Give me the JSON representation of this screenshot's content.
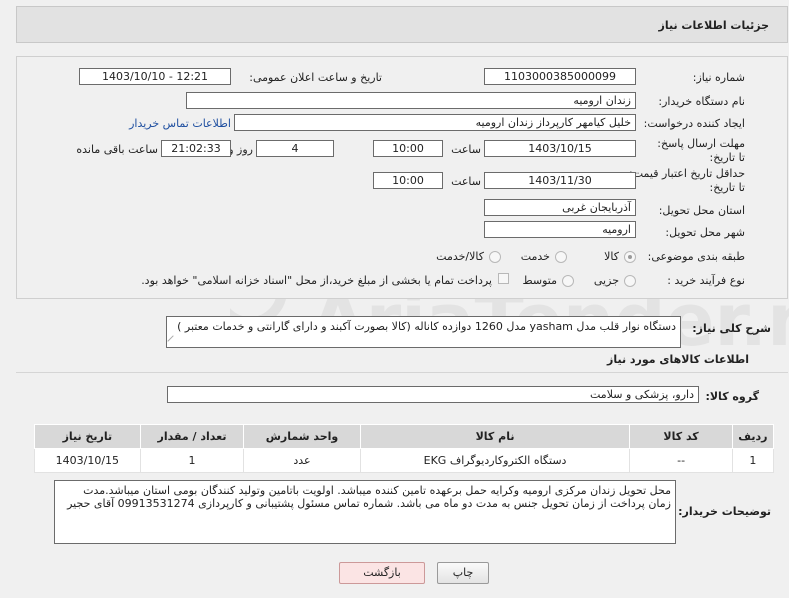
{
  "header": {
    "title": "جزئیات اطلاعات نیاز"
  },
  "form": {
    "need_number_label": "شماره نیاز:",
    "need_number": "1103000385000099",
    "announce_label": "تاریخ و ساعت اعلان عمومی:",
    "announce_value": "1403/10/10 - 12:21",
    "buyer_label": "نام دستگاه خریدار:",
    "buyer_value": "زندان ارومیه",
    "creator_label": "ایجاد کننده درخواست:",
    "creator_value": "خلیل کیامهر کارپرداز زندان ارومیه",
    "contact_link": "اطلاعات تماس خریدار",
    "deadline_label": "مهلت ارسال پاسخ: تا تاریخ:",
    "deadline_date": "1403/10/15",
    "time_label": "ساعت",
    "deadline_time": "10:00",
    "days_value": "4",
    "days_label": "روز و",
    "remaining_time": "21:02:33",
    "remaining_label": "ساعت باقی مانده",
    "validity_label": "حداقل تاریخ اعتبار قیمت: تا تاریخ:",
    "validity_date": "1403/11/30",
    "validity_time": "10:00",
    "province_label": "استان محل تحویل:",
    "province_value": "آذربایجان غربی",
    "city_label": "شهر محل تحویل:",
    "city_value": "ارومیه",
    "category_label": "طبقه بندی موضوعی:",
    "category_options": [
      "کالا",
      "خدمت",
      "کالا/خدمت"
    ],
    "process_label": "نوع فرآیند خرید :",
    "process_options": [
      "جزیی",
      "متوسط"
    ],
    "payment_note": "پرداخت تمام یا بخشی از مبلغ خرید،از محل \"اسناد خزانه اسلامی\" خواهد بود."
  },
  "description": {
    "label": "شرح کلی نیاز:",
    "value": "دستگاه نوار قلب مدل yasham مدل 1260 دوازده کاناله (کالا بصورت آکبند و دارای گارانتی و خدمات معتبر )"
  },
  "goods": {
    "section_title": "اطلاعات کالاهای مورد نیاز",
    "group_label": "گروه کالا:",
    "group_value": "دارو، پزشکی و سلامت",
    "columns": [
      "ردیف",
      "کد کالا",
      "نام کالا",
      "واحد شمارش",
      "تعداد / مقدار",
      "تاریخ نیاز"
    ],
    "rows": [
      [
        "1",
        "--",
        "دستگاه الکتروکاردیوگراف EKG",
        "عدد",
        "1",
        "1403/10/15"
      ]
    ]
  },
  "buyer_notes": {
    "label": "توضیحات خریدار:",
    "value": "محل تحویل زندان مرکزی ارومیه وکرایه حمل برعهده تامین کننده میباشد. اولویت باتامین وتولید کنندگان بومی استان میباشد.مدت زمان پرداخت از زمان تحویل جنس به مدت دو ماه می باشد. شماره تماس مسئول پشتیبانی و کارپردازی 09913531274 آقای حجیر"
  },
  "buttons": {
    "print": "چاپ",
    "back": "بازگشت"
  },
  "watermark": {
    "text": "AriaTender.net"
  },
  "colors": {
    "link": "#1f4fa0",
    "back_button_bg": "#fbe4e4"
  }
}
